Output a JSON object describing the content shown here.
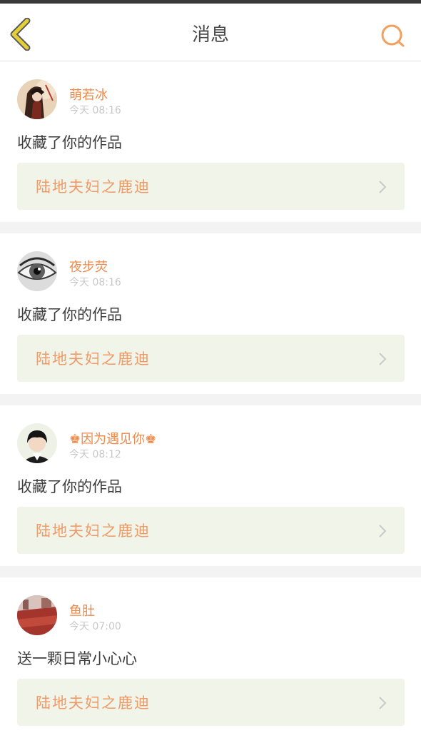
{
  "header": {
    "title": "消息"
  },
  "colors": {
    "accent": "#ef8a4a",
    "back_arrow": "#e4d036",
    "link_background": "#f1f4e9"
  },
  "notifications": [
    {
      "user_name": "萌若冰",
      "time": "今天 08:16",
      "action": "收藏了你的作品",
      "work_title": "陆地夫妇之鹿迪",
      "avatar_icon": "anime-character-avatar"
    },
    {
      "user_name": "夜步荧",
      "time": "今天 08:16",
      "action": "收藏了你的作品",
      "work_title": "陆地夫妇之鹿迪",
      "avatar_icon": "eye-avatar"
    },
    {
      "user_name": "♚因为遇见你♚",
      "time": "今天 08:12",
      "action": "收藏了你的作品",
      "work_title": "陆地夫妇之鹿迪",
      "avatar_icon": "boy-portrait-avatar"
    },
    {
      "user_name": "鱼肚",
      "time": "今天 07:00",
      "action": "送一颗日常小心心",
      "work_title": "陆地夫妇之鹿迪",
      "avatar_icon": "red-scene-avatar"
    }
  ]
}
